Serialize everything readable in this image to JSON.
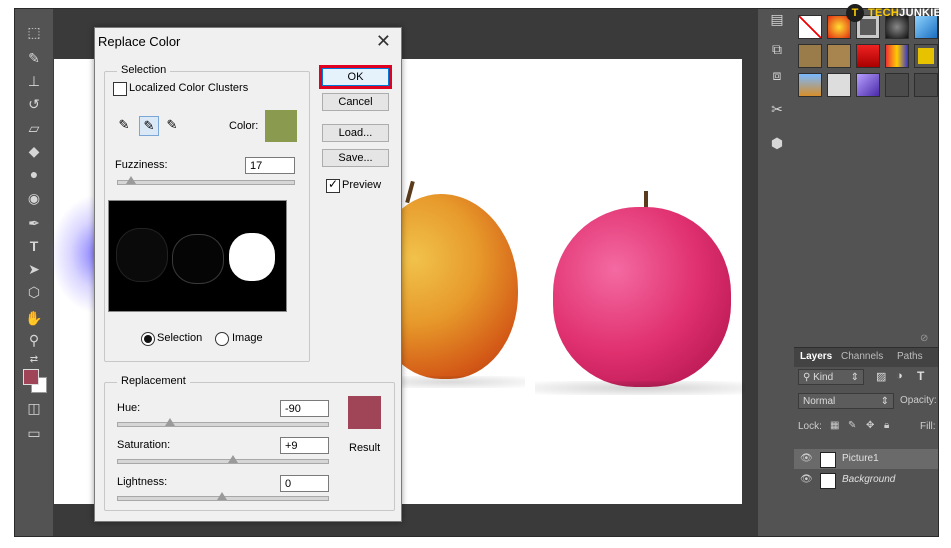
{
  "logo": {
    "badge": "T",
    "prefix": "TECH",
    "suffix": "JUNKIE"
  },
  "toolbar": {
    "tools": [
      "marquee-icon",
      "healing-brush-icon",
      "clone-stamp-icon",
      "history-brush-icon",
      "eraser-icon",
      "paint-bucket-icon",
      "blur-icon",
      "dodge-icon",
      "pen-icon",
      "type-icon",
      "path-selection-icon",
      "shape-icon",
      "hand-icon",
      "zoom-icon"
    ],
    "fg_color": "#a04558",
    "bg_color": "#ffffff"
  },
  "dialog": {
    "title": "Replace Color",
    "close": "✕",
    "selection": {
      "group_label": "Selection",
      "localized_label": "Localized Color Clusters",
      "localized_checked": false,
      "color_label": "Color:",
      "color_value": "#8a9a4f",
      "fuzziness_label": "Fuzziness:",
      "fuzziness_value": "17",
      "fuzziness_level": 0.08,
      "radio_selection": "Selection",
      "radio_image": "Image",
      "selected_radio": "Selection"
    },
    "buttons": {
      "ok": "OK",
      "cancel": "Cancel",
      "load": "Load...",
      "save": "Save...",
      "preview_label": "Preview",
      "preview_checked": true
    },
    "replacement": {
      "group_label": "Replacement",
      "hue_label": "Hue:",
      "hue_value": "-90",
      "hue_level": 0.25,
      "saturation_label": "Saturation:",
      "saturation_value": "+9",
      "saturation_level": 0.55,
      "lightness_label": "Lightness:",
      "lightness_value": "0",
      "lightness_level": 0.5,
      "result_label": "Result",
      "result_color": "#a04558"
    }
  },
  "layers_panel": {
    "tabs": [
      "Layers",
      "Channels",
      "Paths"
    ],
    "kind_label": "Kind",
    "blend_mode": "Normal",
    "opacity_label": "Opacity:",
    "lock_label": "Lock:",
    "fill_label": "Fill:",
    "layers": [
      {
        "name": "Picture1",
        "italic": false,
        "selected": true
      },
      {
        "name": "Background",
        "italic": true,
        "selected": false
      }
    ]
  }
}
